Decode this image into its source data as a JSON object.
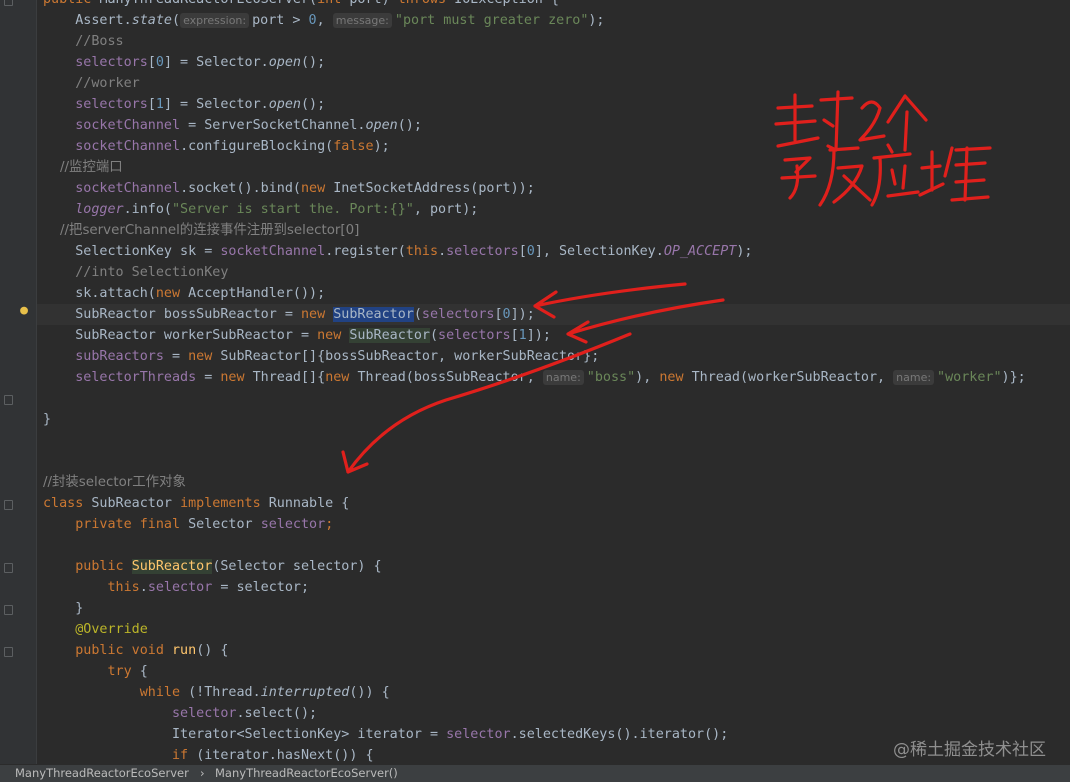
{
  "editor": {
    "lines": [
      {
        "segs": [
          [
            "kw",
            "public "
          ],
          [
            "fn",
            ""
          ],
          [
            "",
            "ManyThreadReactorEcoServer("
          ],
          [
            "kw",
            "int "
          ],
          [
            "",
            "port) "
          ],
          [
            "kw",
            "throws "
          ],
          [
            "",
            "IOException {"
          ]
        ]
      },
      {
        "segs": [
          [
            "",
            "    Assert."
          ],
          [
            "ital",
            "state"
          ],
          [
            "",
            "("
          ],
          [
            "hint",
            "expression:"
          ],
          [
            "",
            "port > "
          ],
          [
            "num",
            "0"
          ],
          [
            "",
            ", "
          ],
          [
            "hint",
            "message:"
          ],
          [
            "str",
            "\"port must greater zero\""
          ],
          [
            "",
            ");"
          ]
        ]
      },
      {
        "segs": [
          [
            "cmt",
            "    //Boss"
          ]
        ]
      },
      {
        "segs": [
          [
            "fld",
            "    selectors"
          ],
          [
            "",
            "["
          ],
          [
            "num",
            "0"
          ],
          [
            "",
            "] = Selector."
          ],
          [
            "ital",
            "open"
          ],
          [
            "",
            "();"
          ]
        ]
      },
      {
        "segs": [
          [
            "cmt",
            "    //worker"
          ]
        ]
      },
      {
        "segs": [
          [
            "fld",
            "    selectors"
          ],
          [
            "",
            "["
          ],
          [
            "num",
            "1"
          ],
          [
            "",
            "] = Selector."
          ],
          [
            "ital",
            "open"
          ],
          [
            "",
            "();"
          ]
        ]
      },
      {
        "segs": [
          [
            "fld",
            "    socketChannel"
          ],
          [
            "",
            " = ServerSocketChannel."
          ],
          [
            "ital",
            "open"
          ],
          [
            "",
            "();"
          ]
        ]
      },
      {
        "segs": [
          [
            "fld",
            "    socketChannel"
          ],
          [
            "",
            ".configureBlocking("
          ],
          [
            "kw",
            "false"
          ],
          [
            "",
            ");"
          ]
        ]
      },
      {
        "segs": [
          [
            "cmt",
            "    //监控端口"
          ]
        ]
      },
      {
        "segs": [
          [
            "fld",
            "    socketChannel"
          ],
          [
            "",
            ".socket().bind("
          ],
          [
            "kw",
            "new "
          ],
          [
            "",
            "InetSocketAddress(port));"
          ]
        ]
      },
      {
        "segs": [
          [
            "fldi",
            "    logger"
          ],
          [
            "",
            ".info("
          ],
          [
            "str",
            "\"Server is start the. Port:{}\""
          ],
          [
            "",
            ", port);"
          ]
        ]
      },
      {
        "segs": [
          [
            "cmt",
            "    //把serverChannel的连接事件注册到selector[0]"
          ]
        ]
      },
      {
        "segs": [
          [
            "",
            "    SelectionKey sk = "
          ],
          [
            "fld",
            "socketChannel"
          ],
          [
            "",
            ".register("
          ],
          [
            "kw",
            "this"
          ],
          [
            "",
            "."
          ],
          [
            "fld",
            "selectors"
          ],
          [
            "",
            "["
          ],
          [
            "num",
            "0"
          ],
          [
            "",
            "], SelectionKey."
          ],
          [
            "fldi",
            "OP_ACCEPT"
          ],
          [
            "",
            ");"
          ]
        ]
      },
      {
        "segs": [
          [
            "cmt",
            "    //into SelectionKey"
          ]
        ]
      },
      {
        "segs": [
          [
            "",
            "    sk.attach("
          ],
          [
            "kw",
            "new "
          ],
          [
            "",
            "AcceptHandler());"
          ]
        ]
      },
      {
        "segs": [
          [
            "",
            "    SubReactor bossSubReactor = "
          ],
          [
            "kw",
            "new "
          ],
          [
            "sel",
            "SubReactor"
          ],
          [
            "",
            "("
          ],
          [
            "fld",
            "selectors"
          ],
          [
            "",
            "["
          ],
          [
            "num",
            "0"
          ],
          [
            "",
            "]);"
          ]
        ],
        "current": true
      },
      {
        "segs": [
          [
            "",
            "    SubReactor workerSubReactor = "
          ],
          [
            "kw",
            "new "
          ],
          [
            "usage",
            "SubReactor"
          ],
          [
            "",
            "("
          ],
          [
            "fld",
            "selectors"
          ],
          [
            "",
            "["
          ],
          [
            "num",
            "1"
          ],
          [
            "",
            "]);"
          ]
        ]
      },
      {
        "segs": [
          [
            "fld",
            "    subReactors"
          ],
          [
            "",
            " = "
          ],
          [
            "kw",
            "new "
          ],
          [
            "",
            "SubReactor[]{bossSubReactor, workerSubReactor};"
          ]
        ]
      },
      {
        "segs": [
          [
            "fld",
            "    selectorThreads"
          ],
          [
            "",
            " = "
          ],
          [
            "kw",
            "new "
          ],
          [
            "",
            "Thread[]{"
          ],
          [
            "kw",
            "new "
          ],
          [
            "",
            "Thread(bossSubReactor, "
          ],
          [
            "hint",
            "name:"
          ],
          [
            "str",
            "\"boss\""
          ],
          [
            "",
            "), "
          ],
          [
            "kw",
            "new "
          ],
          [
            "",
            "Thread(workerSubReactor, "
          ],
          [
            "hint",
            "name:"
          ],
          [
            "str",
            "\"worker\""
          ],
          [
            "",
            ")};"
          ]
        ]
      },
      {
        "segs": [
          [
            "",
            ""
          ]
        ]
      },
      {
        "segs": [
          [
            "",
            "}"
          ]
        ]
      },
      {
        "segs": [
          [
            "",
            ""
          ]
        ]
      },
      {
        "segs": [
          [
            "",
            ""
          ]
        ]
      },
      {
        "segs": [
          [
            "cmt",
            "//封装selector工作对象"
          ]
        ]
      },
      {
        "segs": [
          [
            "kw",
            "class "
          ],
          [
            "",
            "SubReactor "
          ],
          [
            "kw",
            "implements "
          ],
          [
            "",
            "Runnable {"
          ]
        ]
      },
      {
        "segs": [
          [
            "kw",
            "    private final "
          ],
          [
            "",
            "Selector "
          ],
          [
            "fld",
            "selector"
          ],
          [
            "kw",
            ";"
          ]
        ]
      },
      {
        "segs": [
          [
            "",
            ""
          ]
        ]
      },
      {
        "segs": [
          [
            "kw",
            "    public "
          ],
          [
            "usagefn",
            "SubReactor"
          ],
          [
            "",
            "(Selector selector) {"
          ]
        ]
      },
      {
        "segs": [
          [
            "kw",
            "        this"
          ],
          [
            "",
            "."
          ],
          [
            "fld",
            "selector"
          ],
          [
            "",
            " = selector;"
          ]
        ]
      },
      {
        "segs": [
          [
            "",
            "    }"
          ]
        ]
      },
      {
        "segs": [
          [
            "ann",
            "    @Override"
          ]
        ]
      },
      {
        "segs": [
          [
            "kw",
            "    public void "
          ],
          [
            "fn",
            "run"
          ],
          [
            "",
            "() {"
          ]
        ]
      },
      {
        "segs": [
          [
            "kw",
            "        try "
          ],
          [
            "",
            "{"
          ]
        ]
      },
      {
        "segs": [
          [
            "kw",
            "            while "
          ],
          [
            "",
            "(!Thread."
          ],
          [
            "ital",
            "interrupted"
          ],
          [
            "",
            "()) {"
          ]
        ]
      },
      {
        "segs": [
          [
            "fld",
            "                selector"
          ],
          [
            "",
            ".select();"
          ]
        ]
      },
      {
        "segs": [
          [
            "",
            "                Iterator<SelectionKey> iterator = "
          ],
          [
            "fld",
            "selector"
          ],
          [
            "",
            ".selectedKeys().iterator();"
          ]
        ]
      },
      {
        "segs": [
          [
            "kw",
            "                if "
          ],
          [
            "",
            "(iterator.hasNext()) {"
          ]
        ]
      }
    ]
  },
  "breadcrumb": {
    "class_name": "ManyThreadReactorEcoServer",
    "separator": "›",
    "method_name": "ManyThreadReactorEcoServer()"
  },
  "watermark": "@稀土掘金技术社区",
  "handwriting": {
    "line1": "封 2 个",
    "line2": "子反应堆",
    "ink_color": "#e0201c"
  }
}
